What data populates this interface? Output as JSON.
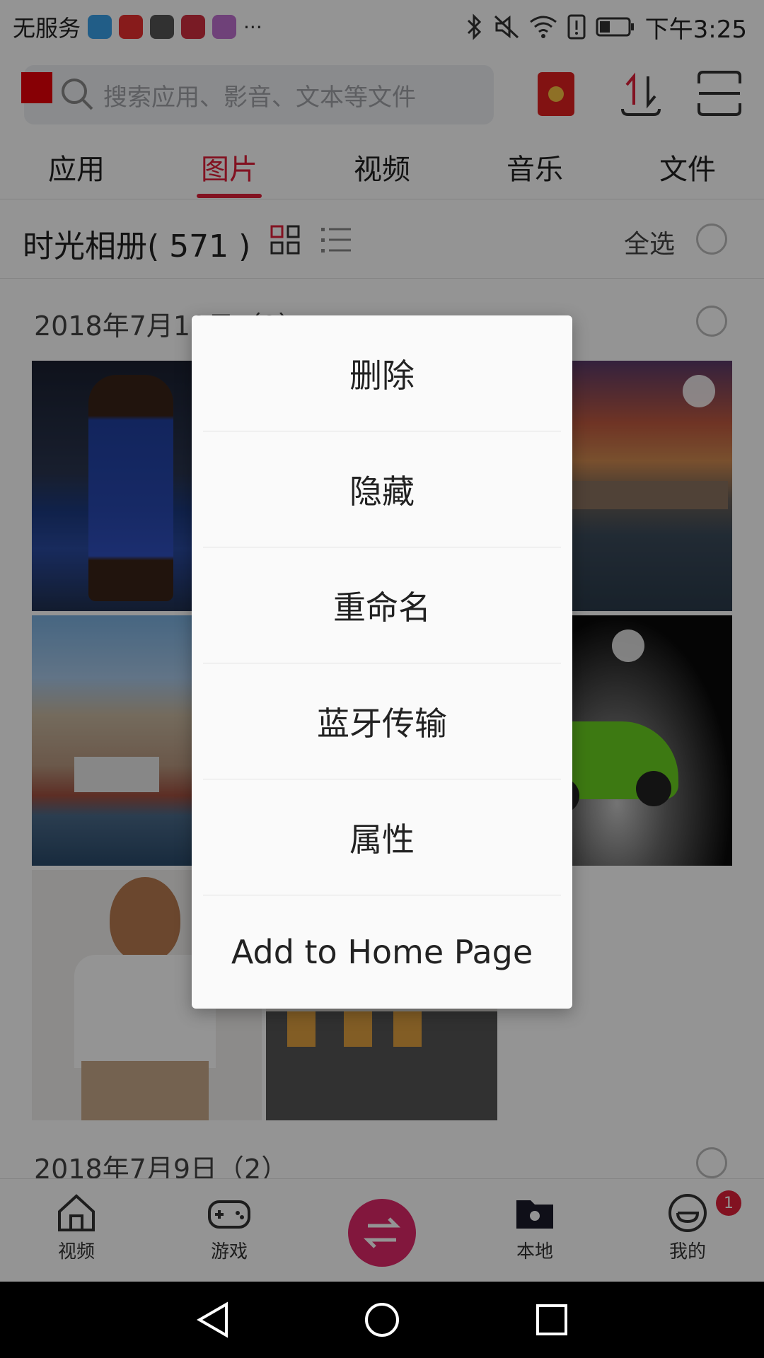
{
  "status_bar": {
    "carrier": "无服务",
    "more": "···",
    "time": "下午3:25"
  },
  "header": {
    "search_placeholder": "搜索应用、影音、文本等文件"
  },
  "tabs": [
    {
      "label": "应用",
      "active": false
    },
    {
      "label": "图片",
      "active": true
    },
    {
      "label": "视频",
      "active": false
    },
    {
      "label": "音乐",
      "active": false
    },
    {
      "label": "文件",
      "active": false
    }
  ],
  "album": {
    "title": "时光相册( 571 )",
    "select_all": "全选"
  },
  "gallery": {
    "groups": [
      {
        "date": "2018年7月10日（9）"
      },
      {
        "date": "2018年7月9日（2）"
      }
    ]
  },
  "bottom_nav": {
    "items": [
      {
        "label": "视频",
        "icon": "home-icon"
      },
      {
        "label": "游戏",
        "icon": "gamepad-icon"
      },
      {
        "label": "",
        "icon": "swap-icon"
      },
      {
        "label": "本地",
        "icon": "folder-icon"
      },
      {
        "label": "我的",
        "icon": "smile-icon"
      }
    ],
    "badge_count": "1"
  },
  "menu": {
    "items": [
      "删除",
      "隐藏",
      "重命名",
      "蓝牙传输",
      "属性",
      "Add to Home Page"
    ]
  },
  "colors": {
    "accent": "#e0203a",
    "center_button": "#e0286a",
    "overlay": "rgba(0,0,0,0.42)"
  }
}
